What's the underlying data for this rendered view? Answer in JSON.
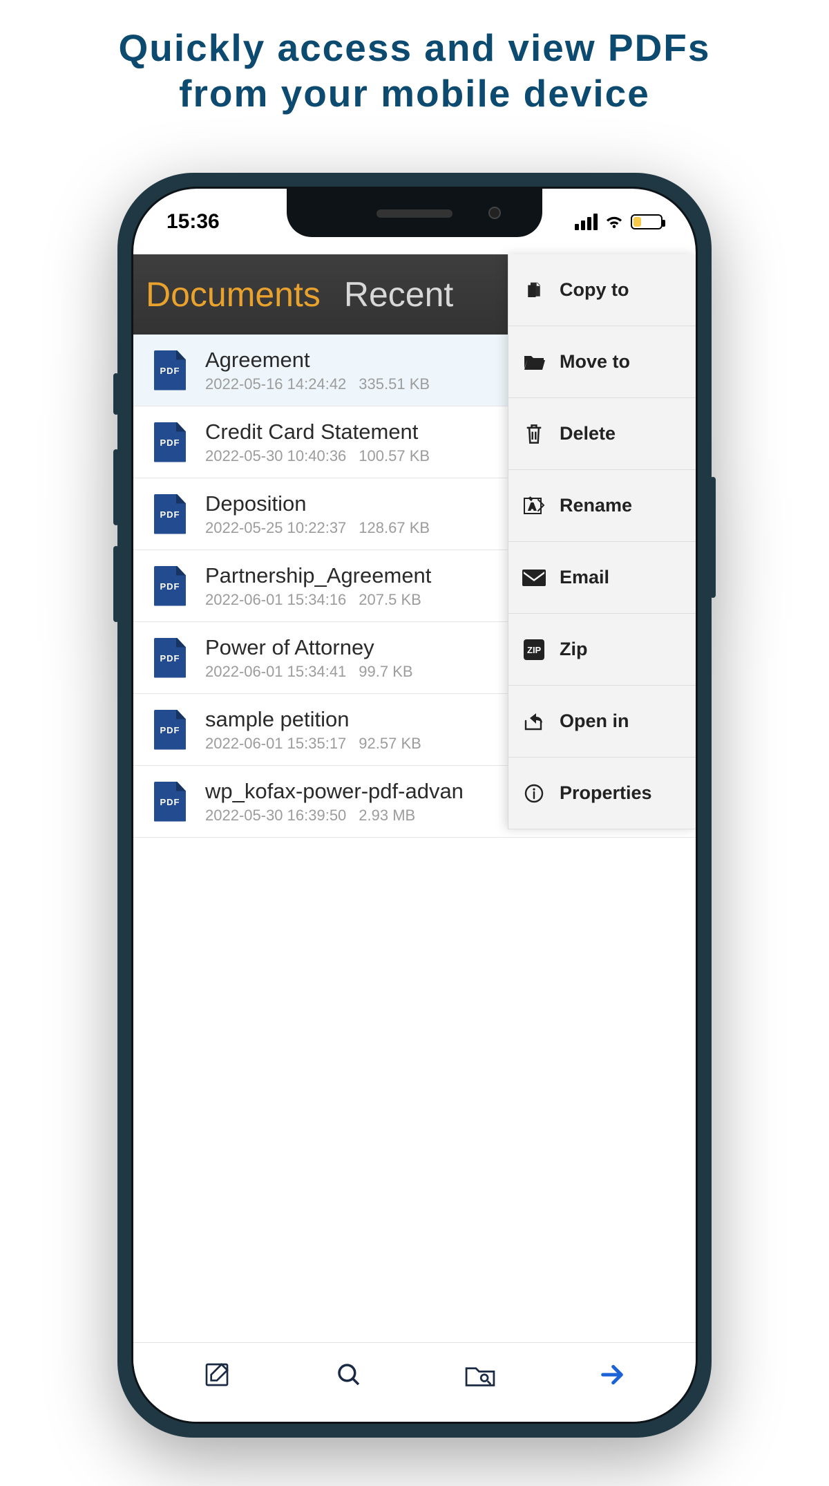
{
  "headline": {
    "line1": "Quickly access and view PDFs",
    "line2": "from your mobile device"
  },
  "statusbar": {
    "time": "15:36"
  },
  "tabs": {
    "documents": "Documents",
    "recent": "Recent"
  },
  "files": [
    {
      "name": "Agreement",
      "date": "2022-05-16 14:24:42",
      "size": "335.51 KB",
      "selected": true
    },
    {
      "name": "Credit Card Statement",
      "date": "2022-05-30 10:40:36",
      "size": "100.57 KB",
      "selected": false
    },
    {
      "name": "Deposition",
      "date": "2022-05-25 10:22:37",
      "size": "128.67 KB",
      "selected": false
    },
    {
      "name": "Partnership_Agreement",
      "date": "2022-06-01 15:34:16",
      "size": "207.5 KB",
      "selected": false
    },
    {
      "name": "Power of Attorney",
      "date": "2022-06-01 15:34:41",
      "size": "99.7 KB",
      "selected": false
    },
    {
      "name": "sample petition",
      "date": "2022-06-01 15:35:17",
      "size": "92.57 KB",
      "selected": false
    },
    {
      "name": "wp_kofax-power-pdf-advan",
      "date": "2022-05-30 16:39:50",
      "size": "2.93 MB",
      "selected": false
    }
  ],
  "pdf_label": "PDF",
  "actions": {
    "copy": "Copy to",
    "move": "Move to",
    "delete": "Delete",
    "rename": "Rename",
    "email": "Email",
    "zip": "Zip",
    "openin": "Open in",
    "props": "Properties"
  }
}
